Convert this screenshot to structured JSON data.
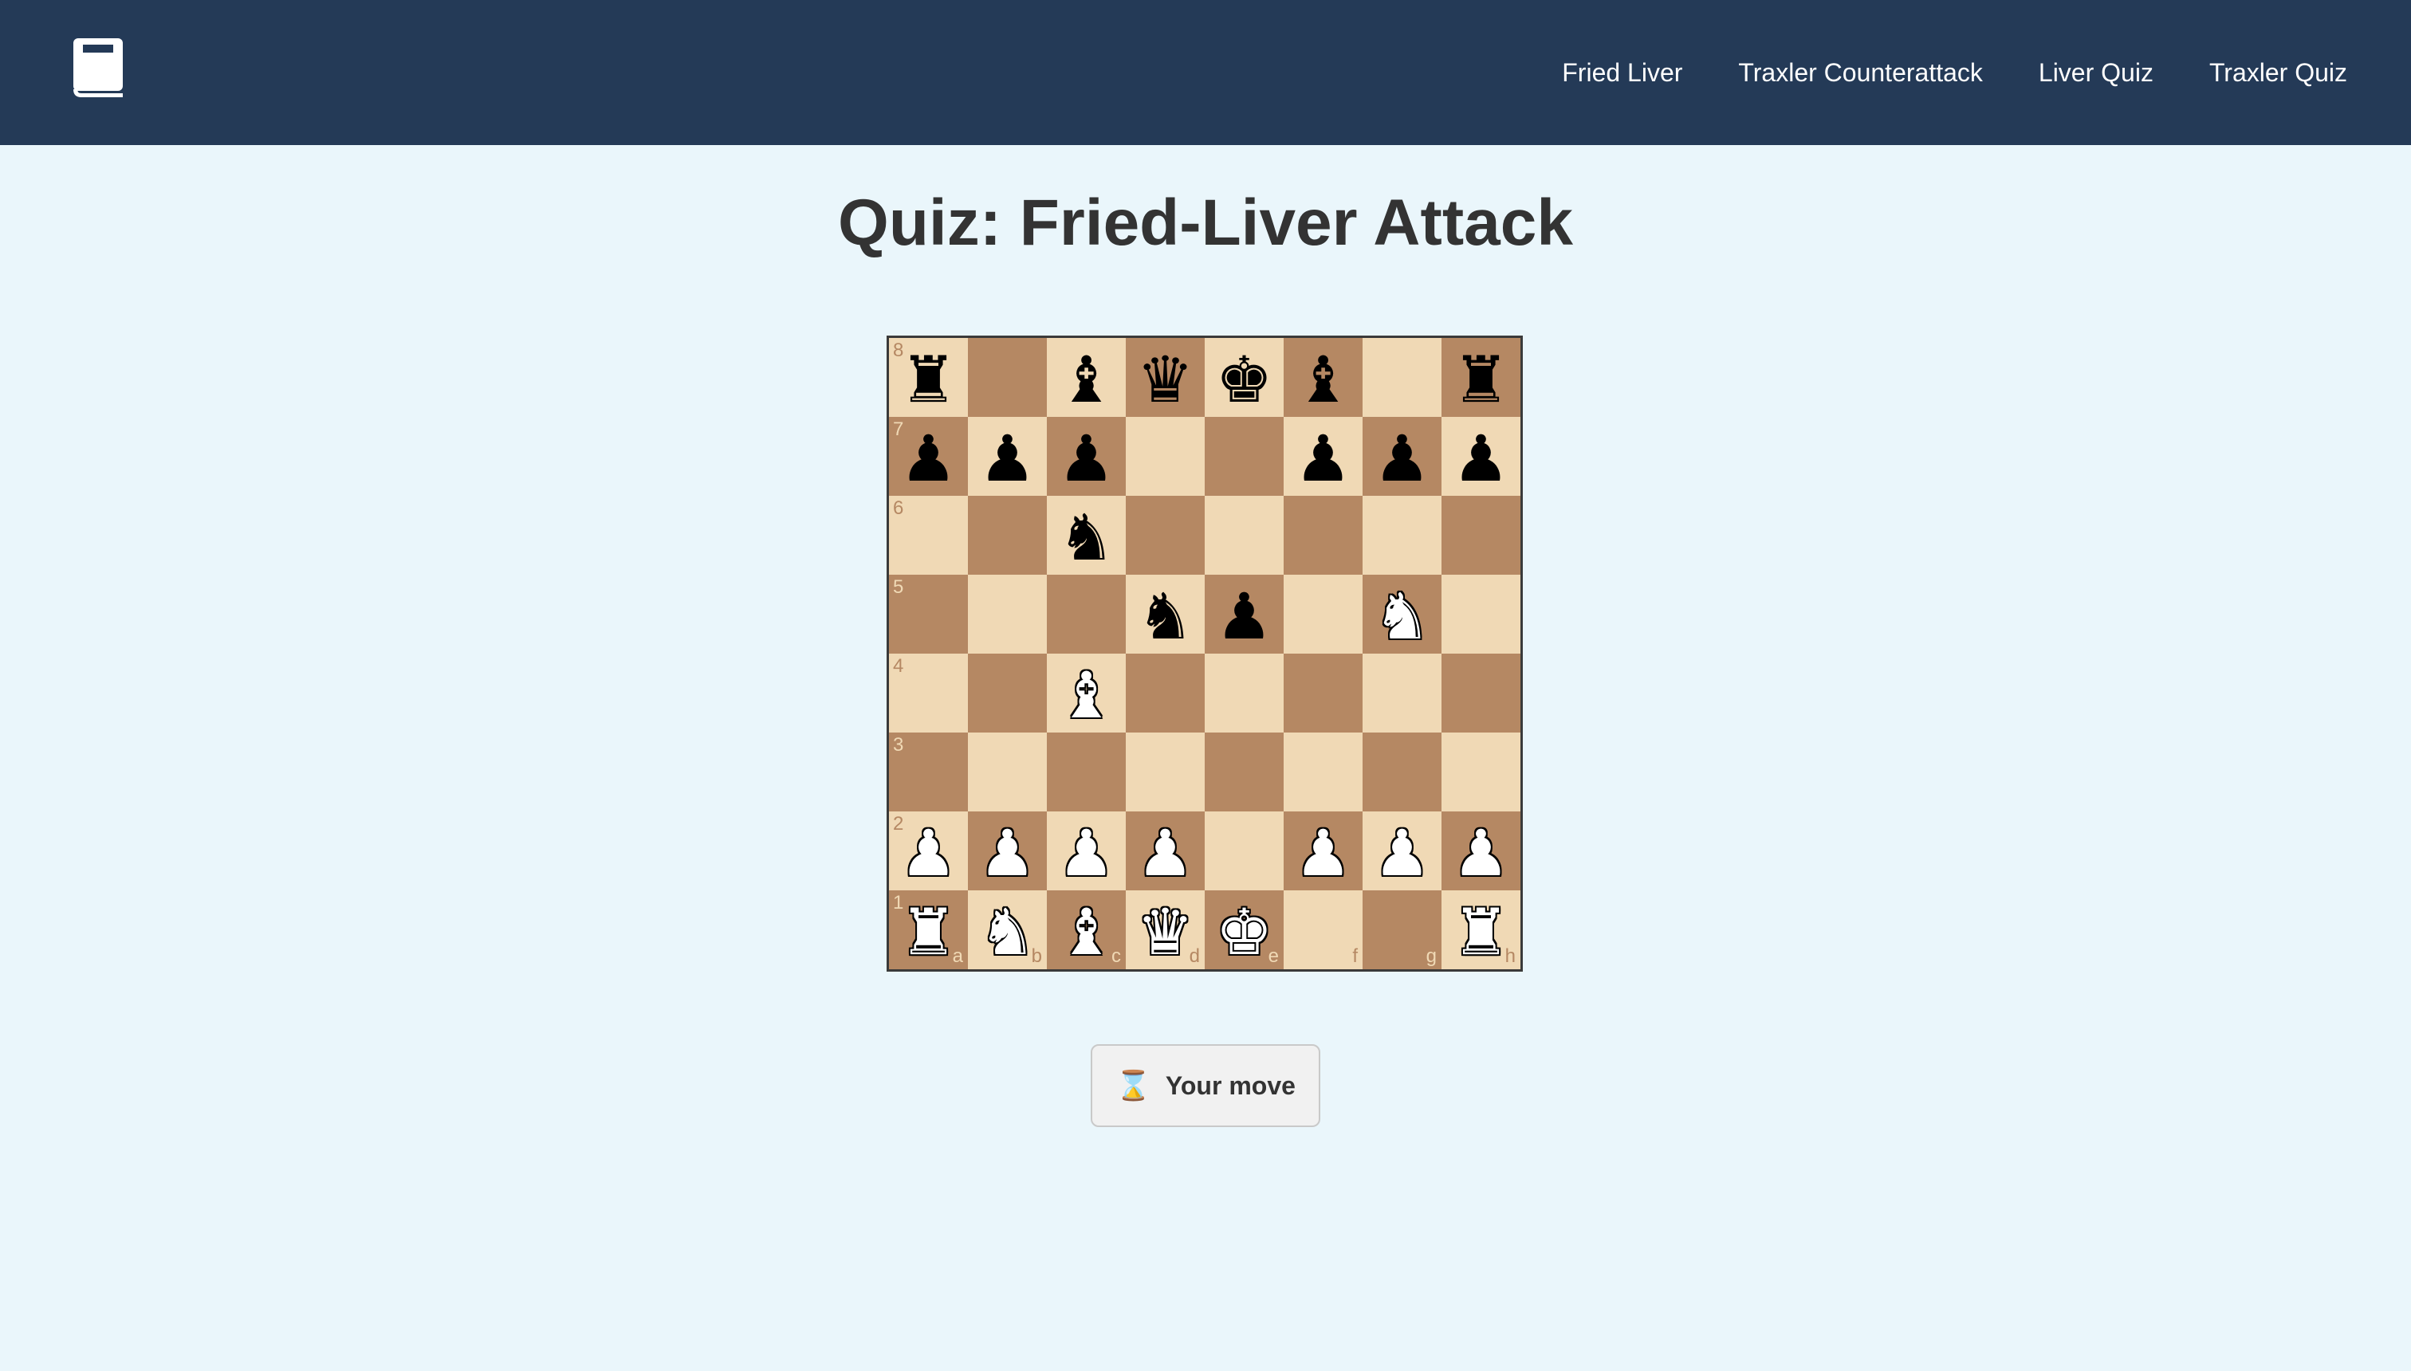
{
  "nav": {
    "logo_icon": "book-icon",
    "links": [
      "Fried Liver",
      "Traxler Counterattack",
      "Liver Quiz",
      "Traxler Quiz"
    ]
  },
  "page": {
    "title": "Quiz: Fried-Liver Attack"
  },
  "board": {
    "orientation": "white",
    "light_color": "#f0d9b5",
    "dark_color": "#b58863",
    "files": [
      "a",
      "b",
      "c",
      "d",
      "e",
      "f",
      "g",
      "h"
    ],
    "ranks": [
      "8",
      "7",
      "6",
      "5",
      "4",
      "3",
      "2",
      "1"
    ],
    "position": [
      [
        "r",
        "",
        "b",
        "q",
        "k",
        "b",
        "",
        "r"
      ],
      [
        "p",
        "p",
        "p",
        "",
        "",
        "p",
        "p",
        "p"
      ],
      [
        "",
        "",
        "n",
        "",
        "",
        "",
        "",
        ""
      ],
      [
        "",
        "",
        "",
        "n",
        "p",
        "",
        "N",
        ""
      ],
      [
        "",
        "",
        "B",
        "",
        "",
        "",
        "",
        ""
      ],
      [
        "",
        "",
        "",
        "",
        "",
        "",
        "",
        ""
      ],
      [
        "P",
        "P",
        "P",
        "P",
        "",
        "P",
        "P",
        "P"
      ],
      [
        "R",
        "N",
        "B",
        "Q",
        "K",
        "",
        "",
        "R"
      ]
    ]
  },
  "status": {
    "icon": "hourglass-icon",
    "text": "Your move"
  }
}
